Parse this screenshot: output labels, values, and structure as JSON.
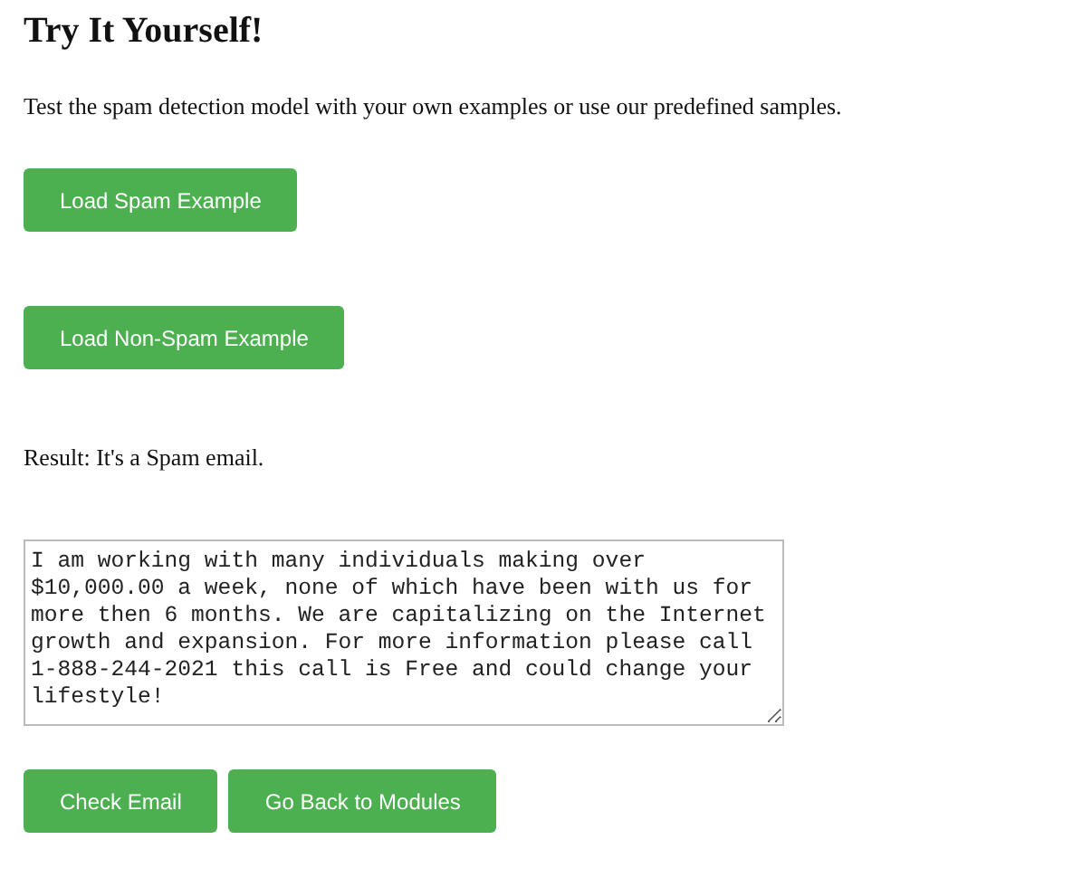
{
  "heading": "Try It Yourself!",
  "intro": "Test the spam detection model with your own examples or use our predefined samples.",
  "example_buttons": [
    "Load Spam Example",
    "Load Non-Spam Example"
  ],
  "result": "Result: It's a Spam email.",
  "email_field": {
    "value": "I am working with many individuals making over $10,000.00 a week, none of which have been with us for more then 6 months. We are capitalizing on the Internet growth and expansion. For more information please call 1-888-244-2021 this call is Free and could change your lifestyle!"
  },
  "action_buttons": [
    "Check Email",
    "Go Back to Modules"
  ]
}
